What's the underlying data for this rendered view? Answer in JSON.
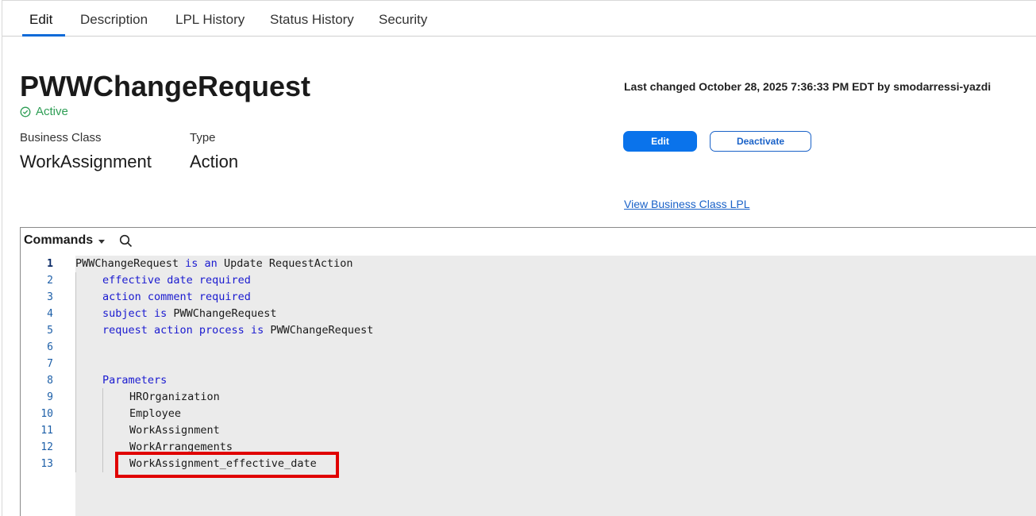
{
  "tabs": [
    {
      "label": "Edit",
      "active": true
    },
    {
      "label": "Description",
      "active": false
    },
    {
      "label": "LPL History",
      "active": false
    },
    {
      "label": "Status History",
      "active": false
    },
    {
      "label": "Security",
      "active": false
    }
  ],
  "header": {
    "title": "PWWChangeRequest",
    "status": "Active",
    "last_changed": "Last changed October 28, 2025 7:36:33 PM EDT by smodarressi-yazdi"
  },
  "fields": {
    "business_class_label": "Business Class",
    "business_class_value": "WorkAssignment",
    "type_label": "Type",
    "type_value": "Action"
  },
  "actions": {
    "edit_label": "Edit",
    "deactivate_label": "Deactivate",
    "view_lpl_label": "View Business Class LPL"
  },
  "editor": {
    "commands_label": "Commands",
    "current_line": 1,
    "lines": [
      {
        "num": "1",
        "indent": 0,
        "parts": [
          {
            "t": "PWWChangeRequest "
          },
          {
            "t": "is an",
            "kw": true
          },
          {
            "t": " Update RequestAction"
          }
        ]
      },
      {
        "num": "2",
        "indent": 1,
        "parts": [
          {
            "t": "effective date required",
            "kw": true
          }
        ]
      },
      {
        "num": "3",
        "indent": 1,
        "parts": [
          {
            "t": "action comment required",
            "kw": true
          }
        ]
      },
      {
        "num": "4",
        "indent": 1,
        "parts": [
          {
            "t": "subject is",
            "kw": true
          },
          {
            "t": " PWWChangeRequest"
          }
        ]
      },
      {
        "num": "5",
        "indent": 1,
        "parts": [
          {
            "t": "request action process is",
            "kw": true
          },
          {
            "t": " PWWChangeRequest"
          }
        ]
      },
      {
        "num": "6",
        "indent": 0,
        "parts": []
      },
      {
        "num": "7",
        "indent": 0,
        "parts": []
      },
      {
        "num": "8",
        "indent": 1,
        "parts": [
          {
            "t": "Parameters",
            "kw": true
          }
        ]
      },
      {
        "num": "9",
        "indent": 2,
        "parts": [
          {
            "t": "HROrganization"
          }
        ]
      },
      {
        "num": "10",
        "indent": 2,
        "parts": [
          {
            "t": "Employee"
          }
        ]
      },
      {
        "num": "11",
        "indent": 2,
        "parts": [
          {
            "t": "WorkAssignment"
          }
        ]
      },
      {
        "num": "12",
        "indent": 2,
        "parts": [
          {
            "t": "WorkArrangements"
          }
        ]
      },
      {
        "num": "13",
        "indent": 2,
        "parts": [
          {
            "t": "WorkAssignment_effective_date"
          }
        ]
      }
    ]
  },
  "colors": {
    "accent": "#0a73eb",
    "active_status": "#2e9e55",
    "keyword": "#1a1ad0",
    "highlight": "#e00000"
  },
  "icons": [
    "check-circle-icon",
    "caret-down-icon",
    "search-icon"
  ]
}
